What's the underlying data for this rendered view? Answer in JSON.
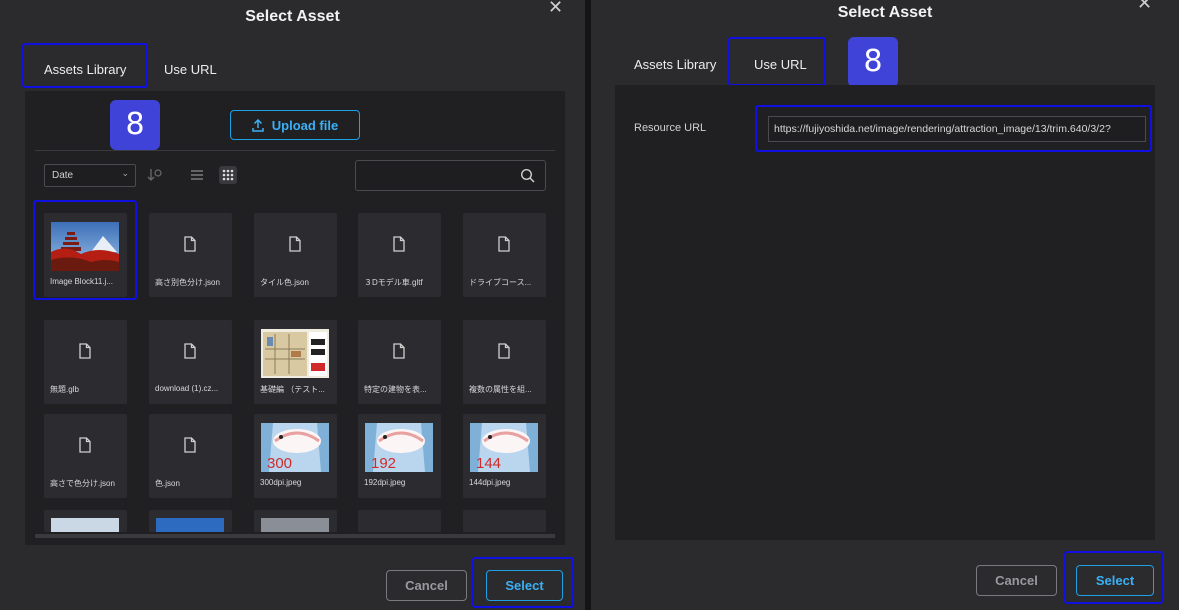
{
  "left": {
    "title": "Select Asset",
    "tabs": [
      "Assets Library",
      "Use URL"
    ],
    "badge": "8",
    "upload_label": "Upload file",
    "sort_select_value": "Date",
    "search_placeholder": "",
    "assets": [
      {
        "label": "Image Block11.j...",
        "kind": "image",
        "thumb": "pagoda"
      },
      {
        "label": "高さ別色分け.json",
        "kind": "file"
      },
      {
        "label": "タイル色.json",
        "kind": "file"
      },
      {
        "label": "３Dモデル車.gltf",
        "kind": "file"
      },
      {
        "label": "ドライブコース...",
        "kind": "file"
      },
      {
        "label": "無題.glb",
        "kind": "file"
      },
      {
        "label": "download (1).cz...",
        "kind": "file"
      },
      {
        "label": "基礎編 （テスト...",
        "kind": "image",
        "thumb": "poster"
      },
      {
        "label": "特定の建物を表...",
        "kind": "file"
      },
      {
        "label": "複数の属性を組...",
        "kind": "file"
      },
      {
        "label": "高さで色分け.json",
        "kind": "file"
      },
      {
        "label": "色.json",
        "kind": "file"
      },
      {
        "label": "300dpi.jpeg",
        "kind": "image",
        "thumb": "shrimp",
        "thumb_text": "300"
      },
      {
        "label": "192dpi.jpeg",
        "kind": "image",
        "thumb": "shrimp",
        "thumb_text": "192"
      },
      {
        "label": "144dpi.jpeg",
        "kind": "image",
        "thumb": "shrimp",
        "thumb_text": "144"
      }
    ],
    "cancel_label": "Cancel",
    "select_label": "Select"
  },
  "right": {
    "title": "Select Asset",
    "tabs": [
      "Assets Library",
      "Use URL"
    ],
    "badge": "8",
    "resource_label": "Resource URL",
    "url_value": "https://fujiyoshida.net/image/rendering/attraction_image/13/trim.640/3/2?",
    "cancel_label": "Cancel",
    "select_label": "Select"
  },
  "colors": {
    "accent": "#1f9fe6",
    "highlight": "#1010e0",
    "badge": "#4043d8"
  }
}
